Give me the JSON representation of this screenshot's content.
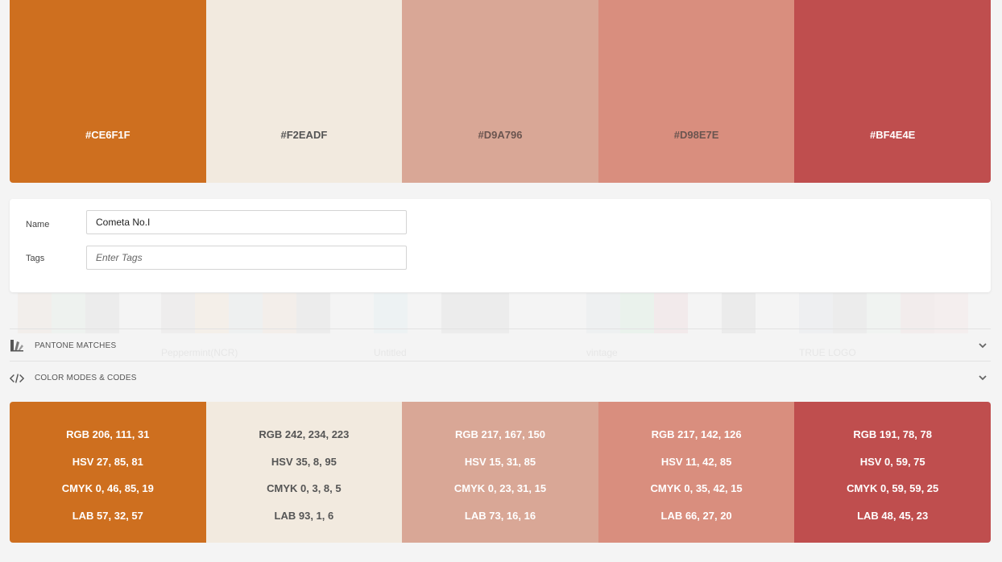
{
  "palette": {
    "swatches": [
      {
        "hex": "#CE6F1F",
        "color": "#CE6F1F",
        "tone": "dark",
        "rgb": "RGB 206, 111, 31",
        "hsv": "HSV 27, 85, 81",
        "cmyk": "CMYK 0, 46, 85, 19",
        "lab": "LAB 57, 32, 57"
      },
      {
        "hex": "#F2EADF",
        "color": "#F2EADF",
        "tone": "light",
        "rgb": "RGB 242, 234, 223",
        "hsv": "HSV 35, 8, 95",
        "cmyk": "CMYK 0, 3, 8, 5",
        "lab": "LAB 93, 1, 6"
      },
      {
        "hex": "#D9A796",
        "color": "#D9A796",
        "tone": "mid",
        "rgb": "RGB 217, 167, 150",
        "hsv": "HSV 15, 31, 85",
        "cmyk": "CMYK 0, 23, 31, 15",
        "lab": "LAB 73, 16, 16"
      },
      {
        "hex": "#D98E7E",
        "color": "#D98E7E",
        "tone": "mid",
        "rgb": "RGB 217, 142, 126",
        "hsv": "HSV 11, 42, 85",
        "cmyk": "CMYK 0, 35, 42, 15",
        "lab": "LAB 66, 27, 20"
      },
      {
        "hex": "#BF4E4E",
        "color": "#BF4E4E",
        "tone": "dark",
        "rgb": "RGB 191, 78, 78",
        "hsv": "HSV 0, 59, 75",
        "cmyk": "CMYK 0, 59, 59, 25",
        "lab": "LAB 48, 45, 23"
      }
    ]
  },
  "form": {
    "name_label": "Name",
    "name_value": "Cometa No.I",
    "tags_label": "Tags",
    "tags_placeholder": "Enter Tags"
  },
  "sections": {
    "pantone": {
      "label": "PANTONE MATCHES",
      "icon": "pantone-icon"
    },
    "modes": {
      "label": "COLOR MODES & CODES",
      "icon": "code-icon"
    }
  },
  "background": {
    "ghost_labels": [
      "Peppermint(NCR)",
      "Untitled",
      "vintage",
      "TRUE LOGO"
    ]
  }
}
